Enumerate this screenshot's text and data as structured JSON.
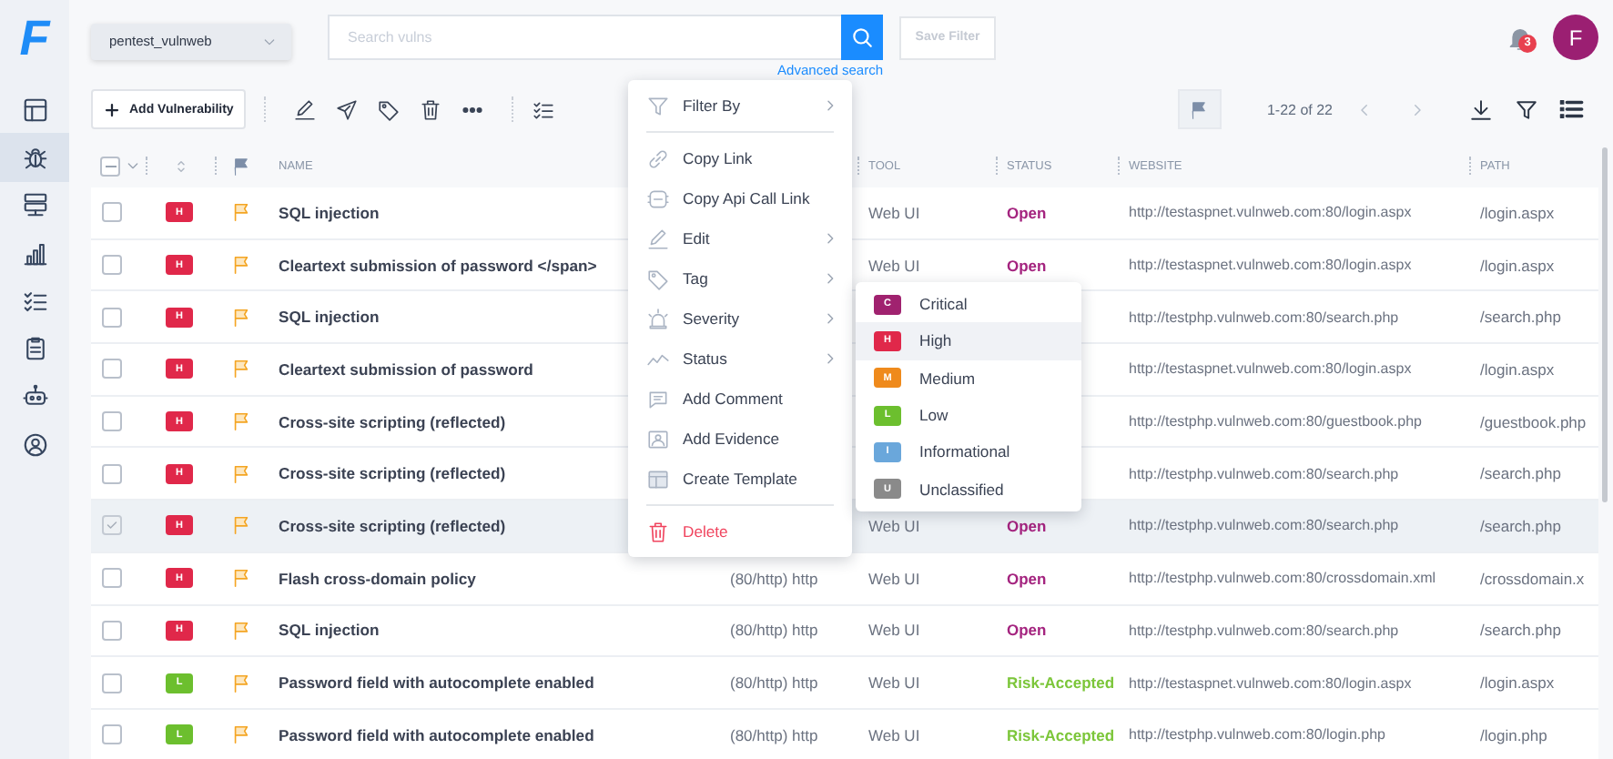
{
  "sidebar": {
    "logo": "F",
    "items": [
      {
        "kind": "dashboard",
        "selected": false
      },
      {
        "kind": "bug",
        "selected": true
      },
      {
        "kind": "servers",
        "selected": false
      },
      {
        "kind": "chart",
        "selected": false
      },
      {
        "kind": "checklist",
        "selected": false
      },
      {
        "kind": "clipboard",
        "selected": false
      },
      {
        "kind": "robot",
        "selected": false
      },
      {
        "kind": "user",
        "selected": false
      }
    ]
  },
  "topbar": {
    "workspace": "pentest_vulnweb",
    "search": {
      "placeholder": "Search vulns"
    },
    "save_filter": {
      "label": "Save Filter",
      "disabled": true
    },
    "advanced_search": "Advanced search",
    "notifications": "3",
    "avatar": "F"
  },
  "toolbar": {
    "add_button": "Add Vulnerability",
    "pagination": "1-22 of 22"
  },
  "table": {
    "header_checkbox": {
      "indeterminate": true
    },
    "columns": [
      "NAME",
      "TOOL",
      "STATUS",
      "WEBSITE",
      "PATH"
    ],
    "rows": [
      {
        "checked": false,
        "selected": false,
        "severity": {
          "letter": "H",
          "color": "#e0284a"
        },
        "name": "SQL injection",
        "tool": "Web UI",
        "status": {
          "label": "Open",
          "color": "#a4247f"
        },
        "website": "http://testaspnet.vulnweb.com:80/login.aspx",
        "path": "/login.aspx"
      },
      {
        "checked": false,
        "selected": false,
        "severity": {
          "letter": "H",
          "color": "#e0284a"
        },
        "name": "Cleartext submission of password </span>",
        "tool": "Web UI",
        "status": {
          "label": "Open",
          "color": "#a4247f"
        },
        "website": "http://testaspnet.vulnweb.com:80/login.aspx",
        "path": "/login.aspx"
      },
      {
        "checked": false,
        "selected": false,
        "severity": {
          "letter": "H",
          "color": "#e0284a"
        },
        "name": "SQL injection",
        "website": "http://testphp.vulnweb.com:80/search.php",
        "path": "/search.php"
      },
      {
        "checked": false,
        "selected": false,
        "severity": {
          "letter": "H",
          "color": "#e0284a"
        },
        "name": "Cleartext submission of password",
        "website": "http://testaspnet.vulnweb.com:80/login.aspx",
        "path": "/login.aspx"
      },
      {
        "checked": false,
        "selected": false,
        "severity": {
          "letter": "H",
          "color": "#e0284a"
        },
        "name": "Cross-site scripting (reflected)",
        "website": "http://testphp.vulnweb.com:80/guestbook.php",
        "path": "/guestbook.php"
      },
      {
        "checked": false,
        "selected": false,
        "severity": {
          "letter": "H",
          "color": "#e0284a"
        },
        "name": "Cross-site scripting (reflected)",
        "website": "http://testphp.vulnweb.com:80/search.php",
        "path": "/search.php"
      },
      {
        "checked": true,
        "selected": true,
        "severity": {
          "letter": "H",
          "color": "#e0284a"
        },
        "name": "Cross-site scripting (reflected)",
        "tool": "Web UI",
        "status": {
          "label": "Open",
          "color": "#a4247f"
        },
        "website": "http://testphp.vulnweb.com:80/search.php",
        "path": "/search.php"
      },
      {
        "checked": false,
        "selected": false,
        "severity": {
          "letter": "H",
          "color": "#e0284a"
        },
        "name": "Flash cross-domain policy",
        "service": "(80/http) http",
        "tool": "Web UI",
        "status": {
          "label": "Open",
          "color": "#a4247f"
        },
        "website": "http://testphp.vulnweb.com:80/crossdomain.xml",
        "path": "/crossdomain.x"
      },
      {
        "checked": false,
        "selected": false,
        "severity": {
          "letter": "H",
          "color": "#e0284a"
        },
        "name": "SQL injection",
        "service": "(80/http) http",
        "tool": "Web UI",
        "status": {
          "label": "Open",
          "color": "#a4247f"
        },
        "website": "http://testphp.vulnweb.com:80/search.php",
        "path": "/search.php"
      },
      {
        "checked": false,
        "selected": false,
        "severity": {
          "letter": "L",
          "color": "#6cbf2e"
        },
        "name": "Password field with autocomplete enabled",
        "service": "(80/http) http",
        "tool": "Web UI",
        "status": {
          "label": "Risk-Accepted",
          "color": "#7cc63a"
        },
        "website": "http://testaspnet.vulnweb.com:80/login.aspx",
        "path": "/login.aspx"
      },
      {
        "checked": false,
        "selected": false,
        "severity": {
          "letter": "L",
          "color": "#6cbf2e"
        },
        "name": "Password field with autocomplete enabled",
        "service": "(80/http) http",
        "tool": "Web UI",
        "status": {
          "label": "Risk-Accepted",
          "color": "#7cc63a"
        },
        "website": "http://testphp.vulnweb.com:80/login.php",
        "path": "/login.php"
      }
    ]
  },
  "context_menu": {
    "items": [
      {
        "kind": "item",
        "label": "Filter By",
        "submenu": true
      },
      {
        "kind": "divider"
      },
      {
        "kind": "item",
        "label": "Copy Link",
        "submenu": false
      },
      {
        "kind": "item",
        "label": "Copy Api Call Link",
        "submenu": false
      },
      {
        "kind": "item",
        "label": "Edit",
        "submenu": true
      },
      {
        "kind": "item",
        "label": "Tag",
        "submenu": true
      },
      {
        "kind": "item",
        "label": "Severity",
        "submenu": true
      },
      {
        "kind": "item",
        "label": "Status",
        "submenu": true
      },
      {
        "kind": "item",
        "label": "Add Comment",
        "submenu": false
      },
      {
        "kind": "item",
        "label": "Add Evidence",
        "submenu": false
      },
      {
        "kind": "item",
        "label": "Create Template",
        "submenu": false
      },
      {
        "kind": "divider"
      },
      {
        "kind": "danger",
        "label": "Delete",
        "submenu": false
      }
    ],
    "severity_submenu": [
      {
        "letter": "C",
        "label": "Critical",
        "color": "#a0226f",
        "selected": false
      },
      {
        "letter": "H",
        "label": "High",
        "color": "#e0284a",
        "selected": true
      },
      {
        "letter": "M",
        "label": "Medium",
        "color": "#ef8a1c",
        "selected": false
      },
      {
        "letter": "L",
        "label": "Low",
        "color": "#6cbf2e",
        "selected": false
      },
      {
        "letter": "I",
        "label": "Informational",
        "color": "#6aa7db",
        "selected": false
      },
      {
        "letter": "U",
        "label": "Unclassified",
        "color": "#8a8a8a",
        "selected": false
      }
    ]
  }
}
